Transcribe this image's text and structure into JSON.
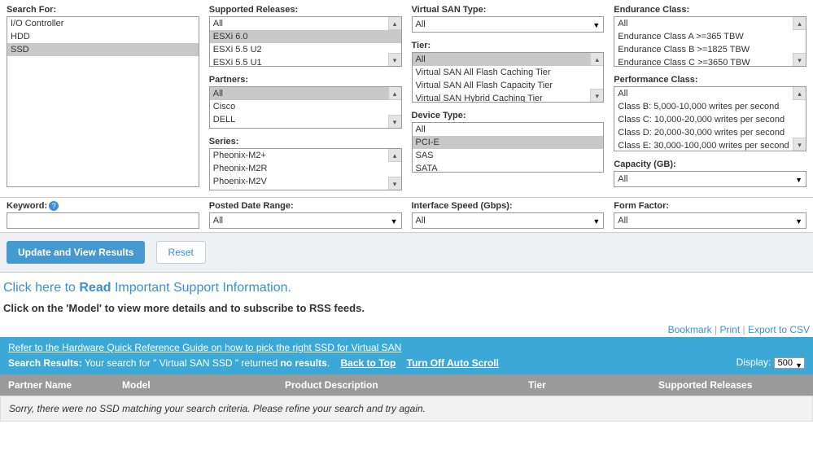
{
  "filters": {
    "search_for": {
      "label": "Search For:",
      "options": [
        "I/O Controller",
        "HDD",
        "SSD"
      ],
      "selected": "SSD"
    },
    "supported_releases": {
      "label": "Supported Releases:",
      "options": [
        "All",
        "ESXi 6.0",
        "ESXi 5.5 U2",
        "ESXi 5.5 U1"
      ],
      "selected": "ESXi 6.0"
    },
    "partners": {
      "label": "Partners:",
      "options": [
        "All",
        "Cisco",
        "DELL"
      ],
      "selected": "All"
    },
    "series": {
      "label": "Series:",
      "options": [
        "Pheonix-M2+",
        "Pheonix-M2R",
        "Phoenix-M2V"
      ]
    },
    "posted_date_range": {
      "label": "Posted Date Range:",
      "value": "All"
    },
    "vsan_type": {
      "label": "Virtual SAN Type:",
      "value": "All"
    },
    "tier": {
      "label": "Tier:",
      "options": [
        "All",
        "Virtual SAN All Flash Caching Tier",
        "Virtual SAN All Flash Capacity Tier",
        "Virtual SAN Hybrid Caching Tier"
      ],
      "selected": "All"
    },
    "device_type": {
      "label": "Device Type:",
      "options": [
        "All",
        "PCI-E",
        "SAS",
        "SATA"
      ],
      "selected": "PCI-E"
    },
    "interface_speed": {
      "label": "Interface Speed (Gbps):",
      "value": "All"
    },
    "endurance_class": {
      "label": "Endurance Class:",
      "options": [
        "All",
        "Endurance Class A >=365 TBW",
        "Endurance Class B >=1825 TBW",
        "Endurance Class C >=3650 TBW"
      ]
    },
    "performance_class": {
      "label": "Performance Class:",
      "options": [
        "All",
        "Class B: 5,000-10,000 writes per second",
        "Class C: 10,000-20,000 writes per second",
        "Class D: 20,000-30,000 writes per second",
        "Class E: 30,000-100,000 writes per second"
      ]
    },
    "capacity": {
      "label": "Capacity (GB):",
      "value": "All"
    },
    "form_factor": {
      "label": "Form Factor:",
      "value": "All"
    },
    "keyword": {
      "label": "Keyword:",
      "value": ""
    }
  },
  "actions": {
    "update": "Update and View Results",
    "reset": "Reset"
  },
  "info_link": {
    "prefix": "Click here to ",
    "read": "Read",
    "suffix": " Important Support Information."
  },
  "hint": "Click on the 'Model' to view more details and to subscribe to RSS feeds.",
  "export_links": {
    "bookmark": "Bookmark",
    "print": "Print",
    "csv": "Export to CSV"
  },
  "results_bar": {
    "guide_link": "Refer to the Hardware Quick Reference Guide on how to pick the right SSD for Virtual SAN",
    "results_label": "Search Results:",
    "results_text_pre": "Your search for \" Virtual SAN SSD \" returned ",
    "results_text_bold": "no results",
    "results_text_post": ".",
    "back_to_top": "Back to Top",
    "auto_scroll": "Turn Off Auto Scroll",
    "display_label": "Display:",
    "display_value": "500"
  },
  "columns": {
    "partner": "Partner Name",
    "model": "Model",
    "desc": "Product Description",
    "tier": "Tier",
    "releases": "Supported Releases"
  },
  "no_results": "Sorry, there were no SSD matching your search criteria. Please refine your search and try again."
}
